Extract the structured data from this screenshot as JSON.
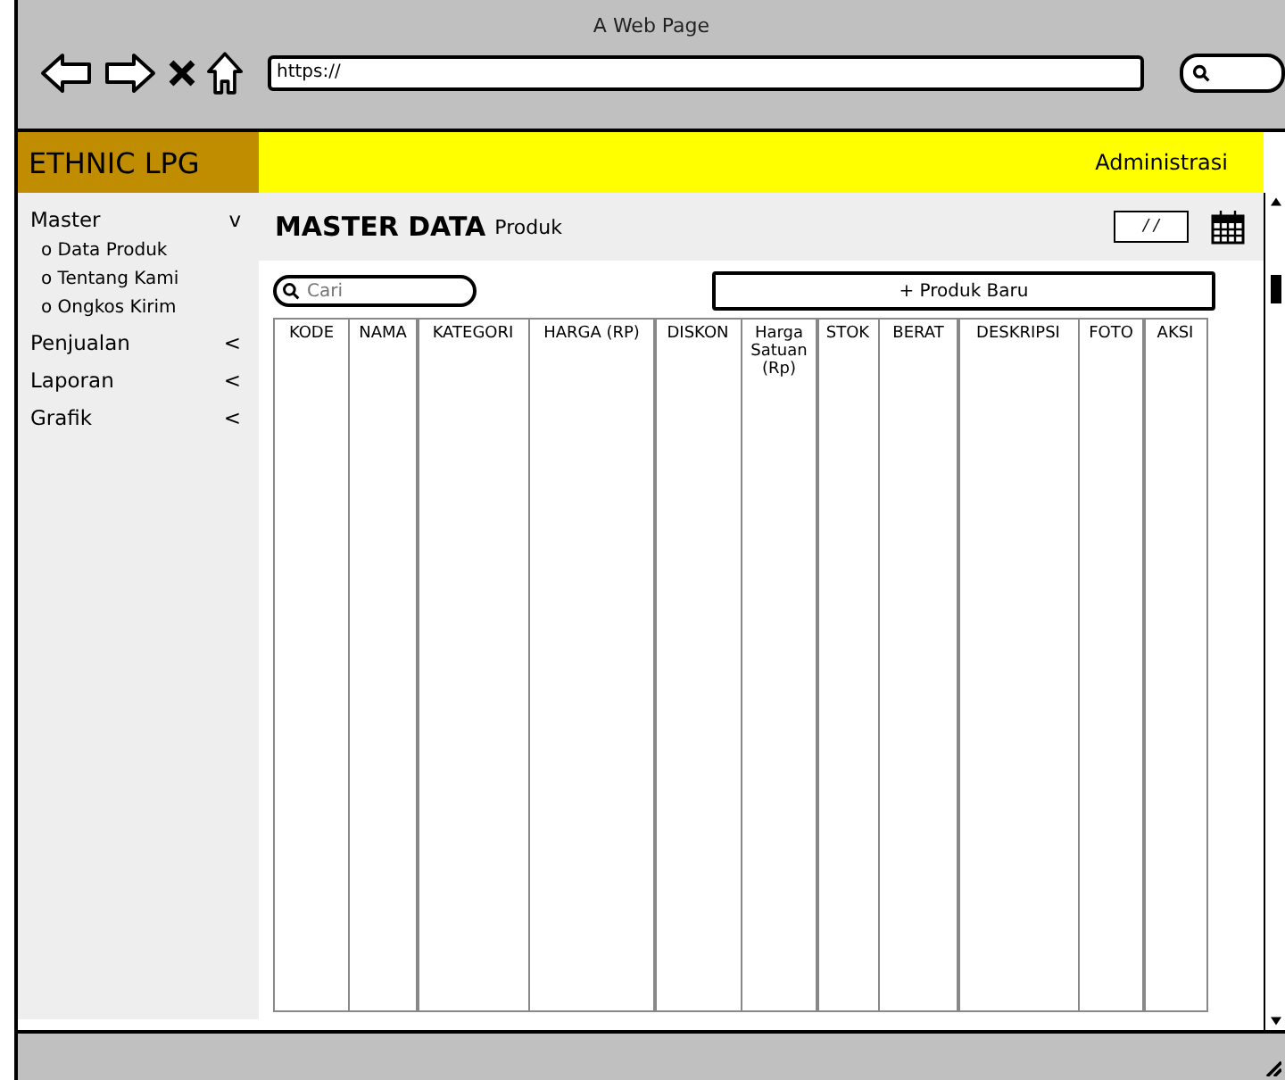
{
  "browser": {
    "title": "A Web Page",
    "url": "https://"
  },
  "header": {
    "logo": "ETHNIC LPG",
    "user": "Administrasi"
  },
  "sidebar": {
    "items": [
      {
        "label": "Master",
        "indicator": "v",
        "children": [
          {
            "label": "o Data Produk"
          },
          {
            "label": "o Tentang Kami"
          },
          {
            "label": "o Ongkos Kirim"
          }
        ]
      },
      {
        "label": "Penjualan",
        "indicator": "<"
      },
      {
        "label": "Laporan",
        "indicator": "<"
      },
      {
        "label": "Grafik",
        "indicator": "<"
      }
    ]
  },
  "page": {
    "title": "MASTER DATA",
    "subtitle": "Produk",
    "date_field": {
      "value": "/ /"
    },
    "search": {
      "placeholder": "Cari"
    },
    "new_button": "+ Produk Baru"
  },
  "table": {
    "columns": [
      "KODE",
      "NAMA",
      "KATEGORI",
      "HARGA (RP)",
      "DISKON",
      "Harga Satuan (Rp)",
      "STOK",
      "BERAT",
      "DESKRIPSI",
      "FOTO",
      "AKSI"
    ]
  }
}
